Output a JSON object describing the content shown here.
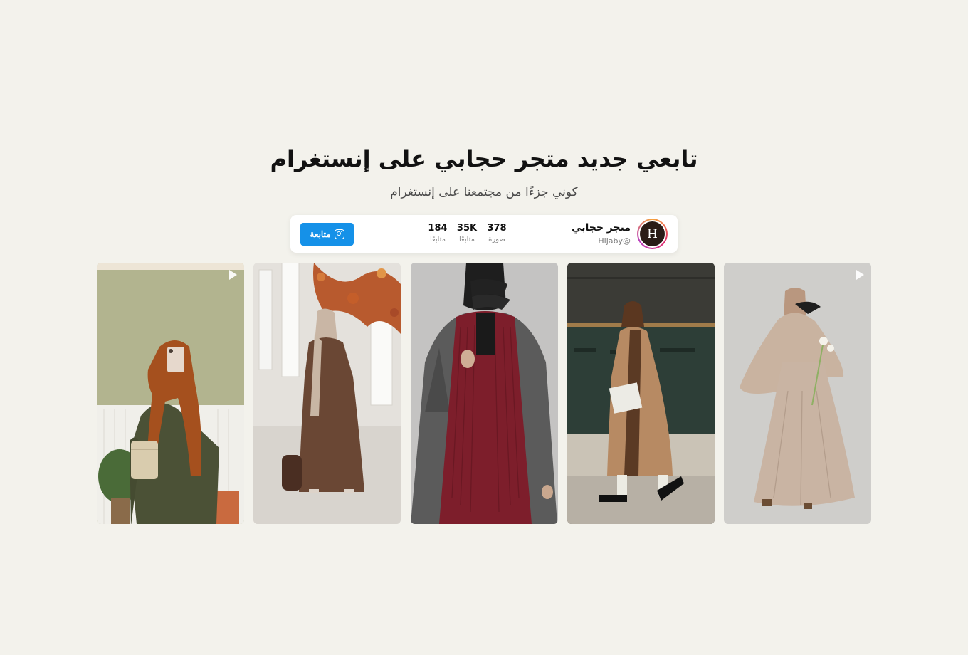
{
  "header": {
    "title": "تابعي جديد متجر حجابي على إنستغرام",
    "subtitle": "كوني جزءًا من مجتمعنا على إنستغرام"
  },
  "profile": {
    "avatar_letter": "H",
    "name": "متجر حجابي",
    "handle": "Hijaby@",
    "stats": [
      {
        "value": "378",
        "label": "صورة"
      },
      {
        "value": "35K",
        "label": "متابعًا"
      },
      {
        "value": "184",
        "label": "متابعًا"
      }
    ],
    "follow_label": "متابعة",
    "follow_icon": "instagram-icon"
  },
  "posts": [
    {
      "id": "olive-dress-mirror-selfie",
      "play_icon": true
    },
    {
      "id": "brown-abaya-indoor",
      "play_icon": false
    },
    {
      "id": "burgundy-scarf-grey-coat",
      "play_icon": false
    },
    {
      "id": "camel-coat-street",
      "play_icon": false
    },
    {
      "id": "beige-khimar-dress",
      "play_icon": true
    }
  ],
  "colors": {
    "background": "#f3f2ec",
    "follow_button": "#1591e8",
    "avatar_bg": "#2a1c17"
  }
}
